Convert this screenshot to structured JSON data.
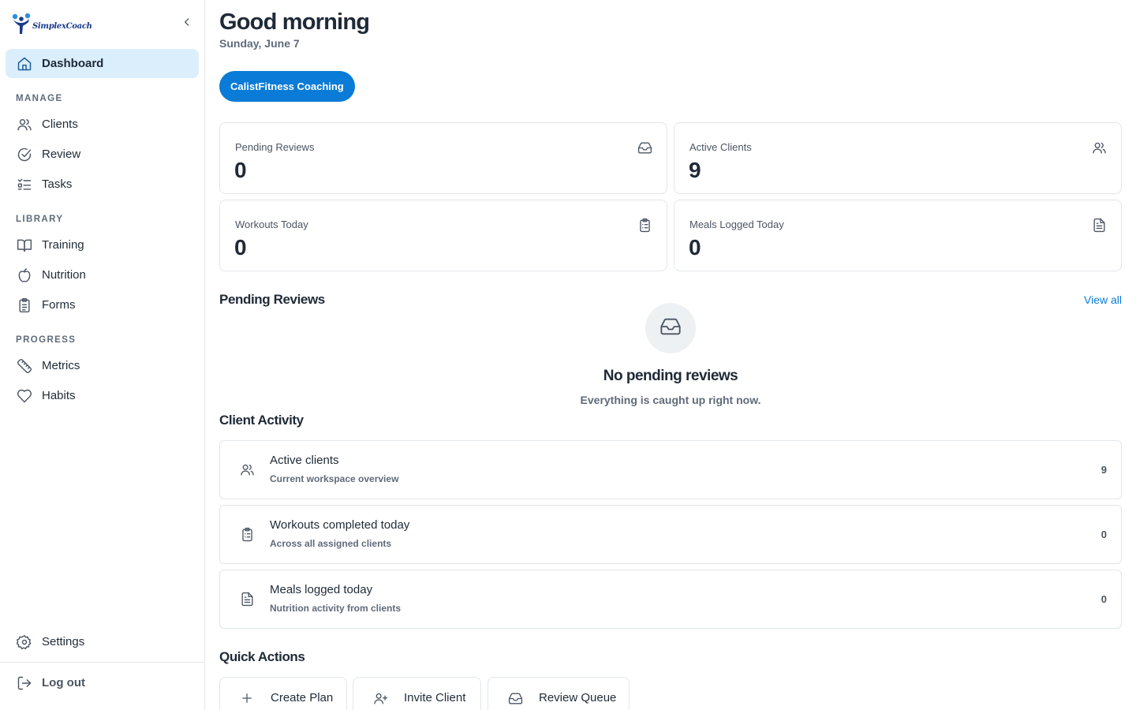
{
  "brand": {
    "name": "SimplexCoach"
  },
  "sidebar": {
    "dashboard": {
      "label": "Dashboard",
      "icon": "home-icon"
    },
    "sections": {
      "manage": "MANAGE",
      "library": "LIBRARY",
      "progress": "PROGRESS"
    },
    "items": {
      "clients": {
        "label": "Clients",
        "icon": "users-icon"
      },
      "review": {
        "label": "Review",
        "icon": "check-circle-icon"
      },
      "tasks": {
        "label": "Tasks",
        "icon": "list-checks-icon"
      },
      "training": {
        "label": "Training",
        "icon": "book-open-icon"
      },
      "nutrition": {
        "label": "Nutrition",
        "icon": "apple-icon"
      },
      "forms": {
        "label": "Forms",
        "icon": "clipboard-icon"
      },
      "metrics": {
        "label": "Metrics",
        "icon": "ruler-icon"
      },
      "habits": {
        "label": "Habits",
        "icon": "heart-icon"
      }
    },
    "settings": {
      "label": "Settings",
      "icon": "gear-icon"
    },
    "logout": {
      "label": "Log out",
      "icon": "logout-icon"
    }
  },
  "header": {
    "greeting": "Good morning",
    "date": "Sunday, June 7",
    "workspace_button": "CalistFitness Coaching"
  },
  "stats": [
    {
      "label": "Pending Reviews",
      "value": "0",
      "icon": "inbox-icon"
    },
    {
      "label": "Active Clients",
      "value": "9",
      "icon": "users-icon"
    },
    {
      "label": "Workouts Today",
      "value": "0",
      "icon": "clipboard-list-icon"
    },
    {
      "label": "Meals Logged Today",
      "value": "0",
      "icon": "file-text-icon"
    }
  ],
  "pending_reviews": {
    "title": "Pending Reviews",
    "view_all": "View all",
    "empty_title": "No pending reviews",
    "empty_subtitle": "Everything is caught up right now."
  },
  "client_activity": {
    "title": "Client Activity",
    "rows": [
      {
        "title": "Active clients",
        "subtitle": "Current workspace overview",
        "count": "9",
        "icon": "users-icon"
      },
      {
        "title": "Workouts completed today",
        "subtitle": "Across all assigned clients",
        "count": "0",
        "icon": "clipboard-list-icon"
      },
      {
        "title": "Meals logged today",
        "subtitle": "Nutrition activity from clients",
        "count": "0",
        "icon": "file-text-icon"
      }
    ]
  },
  "quick_actions": {
    "title": "Quick Actions",
    "buttons": [
      {
        "label": "Create Plan",
        "icon": "plus-icon"
      },
      {
        "label": "Invite Client",
        "icon": "user-plus-icon"
      },
      {
        "label": "Review Queue",
        "icon": "inbox-icon"
      }
    ]
  },
  "colors": {
    "accent": "#0a7bd6",
    "active_nav_bg": "#dbeefb",
    "text_primary": "#1f2a37",
    "text_muted": "#5f6b7a",
    "border": "#e2e6ea"
  }
}
